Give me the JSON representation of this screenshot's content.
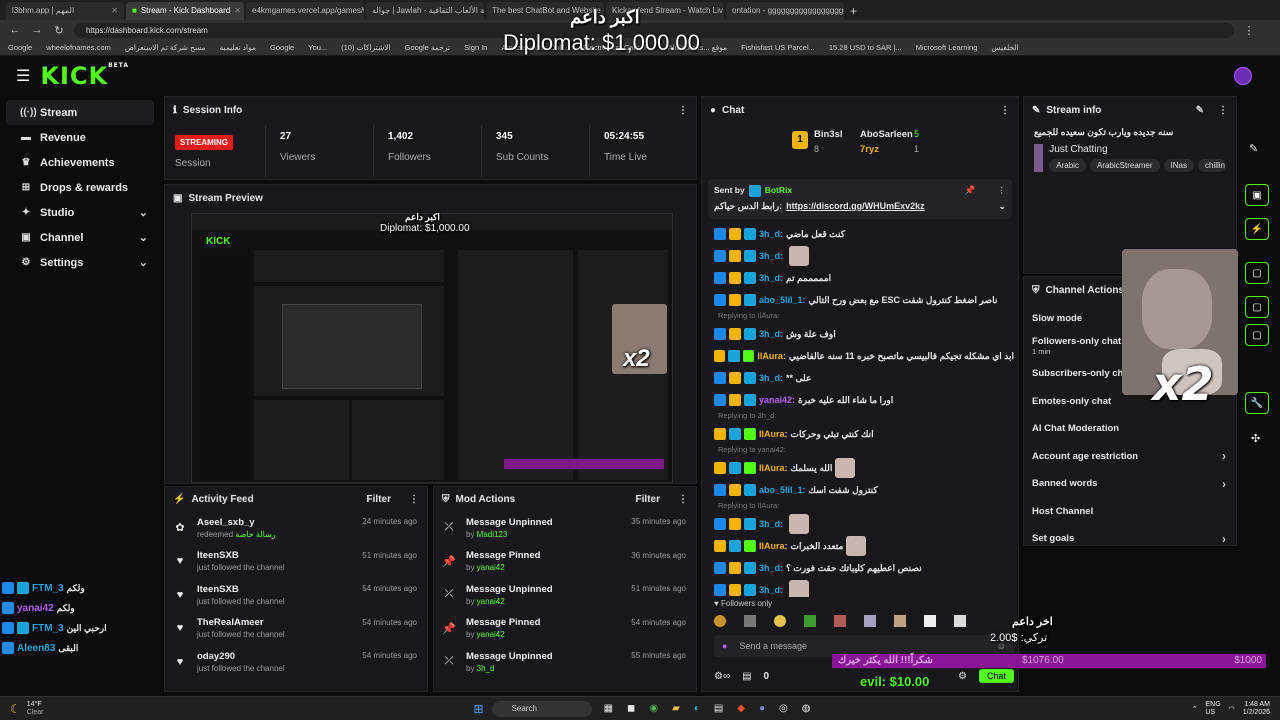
{
  "browser": {
    "tabs": [
      {
        "label": "l3bhm.app | المهم"
      },
      {
        "label": "Stream - Kick Dashboard"
      },
      {
        "label": "e4kmgames.vercel.app/games/w"
      },
      {
        "label": "جواله | Jawlah - منصة الألعاب الثقافية"
      },
      {
        "label": "The best ChatBot and Website"
      },
      {
        "label": "Kickawfend Stream - Watch Liv"
      },
      {
        "label": "ontation - gggggggggggggggggg"
      }
    ],
    "url": "https://dashboard.kick.com/stream",
    "bookmarks": [
      "Google",
      "wheelofnames.com",
      "مسح شركة تم الاستعراض",
      "مواد تعليمية",
      "Google",
      "You...",
      "الاشتراكات (10)",
      "Google ترجمة",
      "Sign In",
      "Amazon.com: Onli...",
      "Electronics, Cars, F...",
      "AliExpress... موقع",
      "Fishisfast US Parcel...",
      "15.28 USD to SAR |...",
      "Microsoft Learning",
      "الخلفيس"
    ]
  },
  "overlays": {
    "top_arabic": "اكبر داعم",
    "top_amount": "Diplomat: $1,000.00",
    "bottom_supporter_label": "اخر داعم",
    "bottom_supporter_amount": "تركي: $2.00",
    "goal_text": "شكراً!!! الله يكثر خيرك",
    "goal_current": "$1076.00",
    "goal_target": "$1000",
    "evil_amount": "evil: $10.00",
    "x2_label": "x2",
    "left_chat": [
      {
        "user": "FTM_3",
        "msg": "ولكم"
      },
      {
        "user": "yanai42",
        "msg": "ولكم"
      },
      {
        "user": "FTM_3",
        "msg": "ارحبي الين"
      },
      {
        "user": "Aleen83",
        "msg": "البقى"
      }
    ]
  },
  "sidebar": {
    "items": [
      {
        "label": "Stream",
        "icon": "broadcast-icon"
      },
      {
        "label": "Revenue",
        "icon": "money-icon"
      },
      {
        "label": "Achievements",
        "icon": "trophy-icon"
      },
      {
        "label": "Drops & rewards",
        "icon": "gift-icon"
      },
      {
        "label": "Studio",
        "icon": "studio-icon"
      },
      {
        "label": "Channel",
        "icon": "channel-icon"
      },
      {
        "label": "Settings",
        "icon": "gear-icon"
      }
    ]
  },
  "session": {
    "title": "Session Info",
    "status": "STREAMING",
    "status_label": "Session",
    "stats": [
      {
        "value": "27",
        "label": "Viewers"
      },
      {
        "value": "1,402",
        "label": "Followers"
      },
      {
        "value": "345",
        "label": "Sub Counts"
      },
      {
        "value": "05:24:55",
        "label": "Time Live"
      }
    ]
  },
  "preview": {
    "title": "Stream Preview"
  },
  "activity": {
    "title": "Activity Feed",
    "filter": "Filter",
    "rows": [
      {
        "name": "Aseel_sxb_y",
        "sub_prefix": "redeemed",
        "sub_hl": "رسالة خاصة",
        "time": "24 minutes ago",
        "icon": "reward-icon"
      },
      {
        "name": "IteenSXB",
        "sub_prefix": "just followed the channel",
        "sub_hl": "",
        "time": "51 minutes ago",
        "icon": "heart-icon"
      },
      {
        "name": "IteenSXB",
        "sub_prefix": "just followed the channel",
        "sub_hl": "",
        "time": "54 minutes ago",
        "icon": "heart-icon"
      },
      {
        "name": "TheRealAmeer",
        "sub_prefix": "just followed the channel",
        "sub_hl": "",
        "time": "54 minutes ago",
        "icon": "heart-icon"
      },
      {
        "name": "oday290",
        "sub_prefix": "just followed the channel",
        "sub_hl": "",
        "time": "54 minutes ago",
        "icon": "heart-icon"
      }
    ]
  },
  "mod": {
    "title": "Mod Actions",
    "filter": "Filter",
    "rows": [
      {
        "name": "Message Unpinned",
        "by": "Madi123",
        "time": "35 minutes ago",
        "icon": "unpin-icon"
      },
      {
        "name": "Message Pinned",
        "by": "yanai42",
        "time": "36 minutes ago",
        "icon": "pin-icon"
      },
      {
        "name": "Message Unpinned",
        "by": "yanai42",
        "time": "51 minutes ago",
        "icon": "unpin-icon"
      },
      {
        "name": "Message Pinned",
        "by": "yanai42",
        "time": "54 minutes ago",
        "icon": "pin-icon"
      },
      {
        "name": "Message Unpinned",
        "by": "3h_d",
        "time": "55 minutes ago",
        "icon": "unpin-icon"
      }
    ]
  },
  "chat": {
    "title": "Chat",
    "top": [
      {
        "rank": "1",
        "name": "Bin3sl",
        "count": "8"
      },
      {
        "rank": "",
        "name": "AboSarleen",
        "count": "5"
      },
      {
        "rank": "",
        "name": "7ryz",
        "count": "1"
      }
    ],
    "pinned": {
      "sent_by": "Sent by",
      "user": "BotRix",
      "text": "رابط الدس حياكم:",
      "link": "https://discord.gg/WHUmExv2kz"
    },
    "messages": [
      {
        "reply": "",
        "user": "3h_d:",
        "text": "كنت قعل ماضي",
        "color": "#1aa3d9",
        "emote": false
      },
      {
        "reply": "",
        "user": "3h_d:",
        "text": "",
        "color": "#1aa3d9",
        "emote": true
      },
      {
        "reply": "",
        "user": "3h_d:",
        "text": "امممممم تم",
        "color": "#1aa3d9",
        "emote": false
      },
      {
        "reply": "",
        "user": "abo_5lil_1:",
        "text": "مع بعض ورح التالي ESC ناصر اضغط كنترول شفت",
        "color": "#1aa3d9",
        "emote": false
      },
      {
        "reply": "Replying to IlAura:",
        "user": "3h_d:",
        "text": "اوف علة وش",
        "color": "#1aa3d9",
        "emote": false
      },
      {
        "reply": "",
        "user": "IlAura:",
        "text": "ابد اي مشكله تجيكم فالبيسي ماتصبح خبره 11 سنه عالفاضيي",
        "color": "#f5b400",
        "emote": false
      },
      {
        "reply": "",
        "user": "3h_d:",
        "text": "** على",
        "color": "#1aa3d9",
        "emote": false
      },
      {
        "reply": "",
        "user": "yanai42:",
        "text": "اورا ما شاء الله عليه خبرة",
        "color": "#b45cff",
        "emote": false
      },
      {
        "reply": "Replying to 3h_d:",
        "user": "IlAura:",
        "text": "انك كنتي تبثي وحركات",
        "color": "#f5b400",
        "emote": false
      },
      {
        "reply": "Replying to yanai42:",
        "user": "IlAura:",
        "text": "الله يسلمك",
        "color": "#f5b400",
        "emote": true
      },
      {
        "reply": "",
        "user": "abo_5lil_1:",
        "text": "كنترول شفت اسك",
        "color": "#1aa3d9",
        "emote": false
      },
      {
        "reply": "Replying to IlAura:",
        "user": "3h_d:",
        "text": "",
        "color": "#1aa3d9",
        "emote": true
      },
      {
        "reply": "",
        "user": "IlAura:",
        "text": "متعدد الخبرات",
        "color": "#f5b400",
        "emote": true
      },
      {
        "reply": "",
        "user": "3h_d:",
        "text": "نصنص اعطيهم كليباتك حقت فورت ؟",
        "color": "#1aa3d9",
        "emote": false
      },
      {
        "reply": "",
        "user": "3h_d:",
        "text": "",
        "color": "#1aa3d9",
        "emote": true
      }
    ],
    "followers_only": "Followers only",
    "placeholder": "Send a message",
    "points": "0",
    "send": "Chat"
  },
  "streaminfo": {
    "title": "Stream info",
    "stream_title": "سنه جديده ويارب تكون سعيده للجميع",
    "category": "Just Chatting",
    "tags": [
      "Arabic",
      "ArabicStreamer",
      "INas",
      "chillin"
    ]
  },
  "channel_actions": {
    "title": "Channel Actions",
    "items": [
      {
        "label": "Slow mode",
        "sub": "",
        "arrow": false
      },
      {
        "label": "Followers-only chat",
        "sub": "1 min",
        "arrow": false
      },
      {
        "label": "Subscribers-only chat",
        "sub": "",
        "arrow": false
      },
      {
        "label": "Emotes-only chat",
        "sub": "",
        "arrow": false
      },
      {
        "label": "AI Chat Moderation",
        "sub": "",
        "arrow": false
      },
      {
        "label": "Account age restriction",
        "sub": "",
        "arrow": true
      },
      {
        "label": "Banned words",
        "sub": "",
        "arrow": true
      },
      {
        "label": "Host Channel",
        "sub": "",
        "arrow": false
      },
      {
        "label": "Set goals",
        "sub": "",
        "arrow": true
      }
    ]
  },
  "taskbar": {
    "search": "Search",
    "weather_temp": "14°F",
    "weather_text": "Clear",
    "lang": "ENG",
    "region": "US",
    "time": "1:48 AM",
    "date": "1/2/2026"
  },
  "colors": {
    "accent": "#53fc18",
    "live": "#e91916",
    "panel": "#18181b"
  }
}
